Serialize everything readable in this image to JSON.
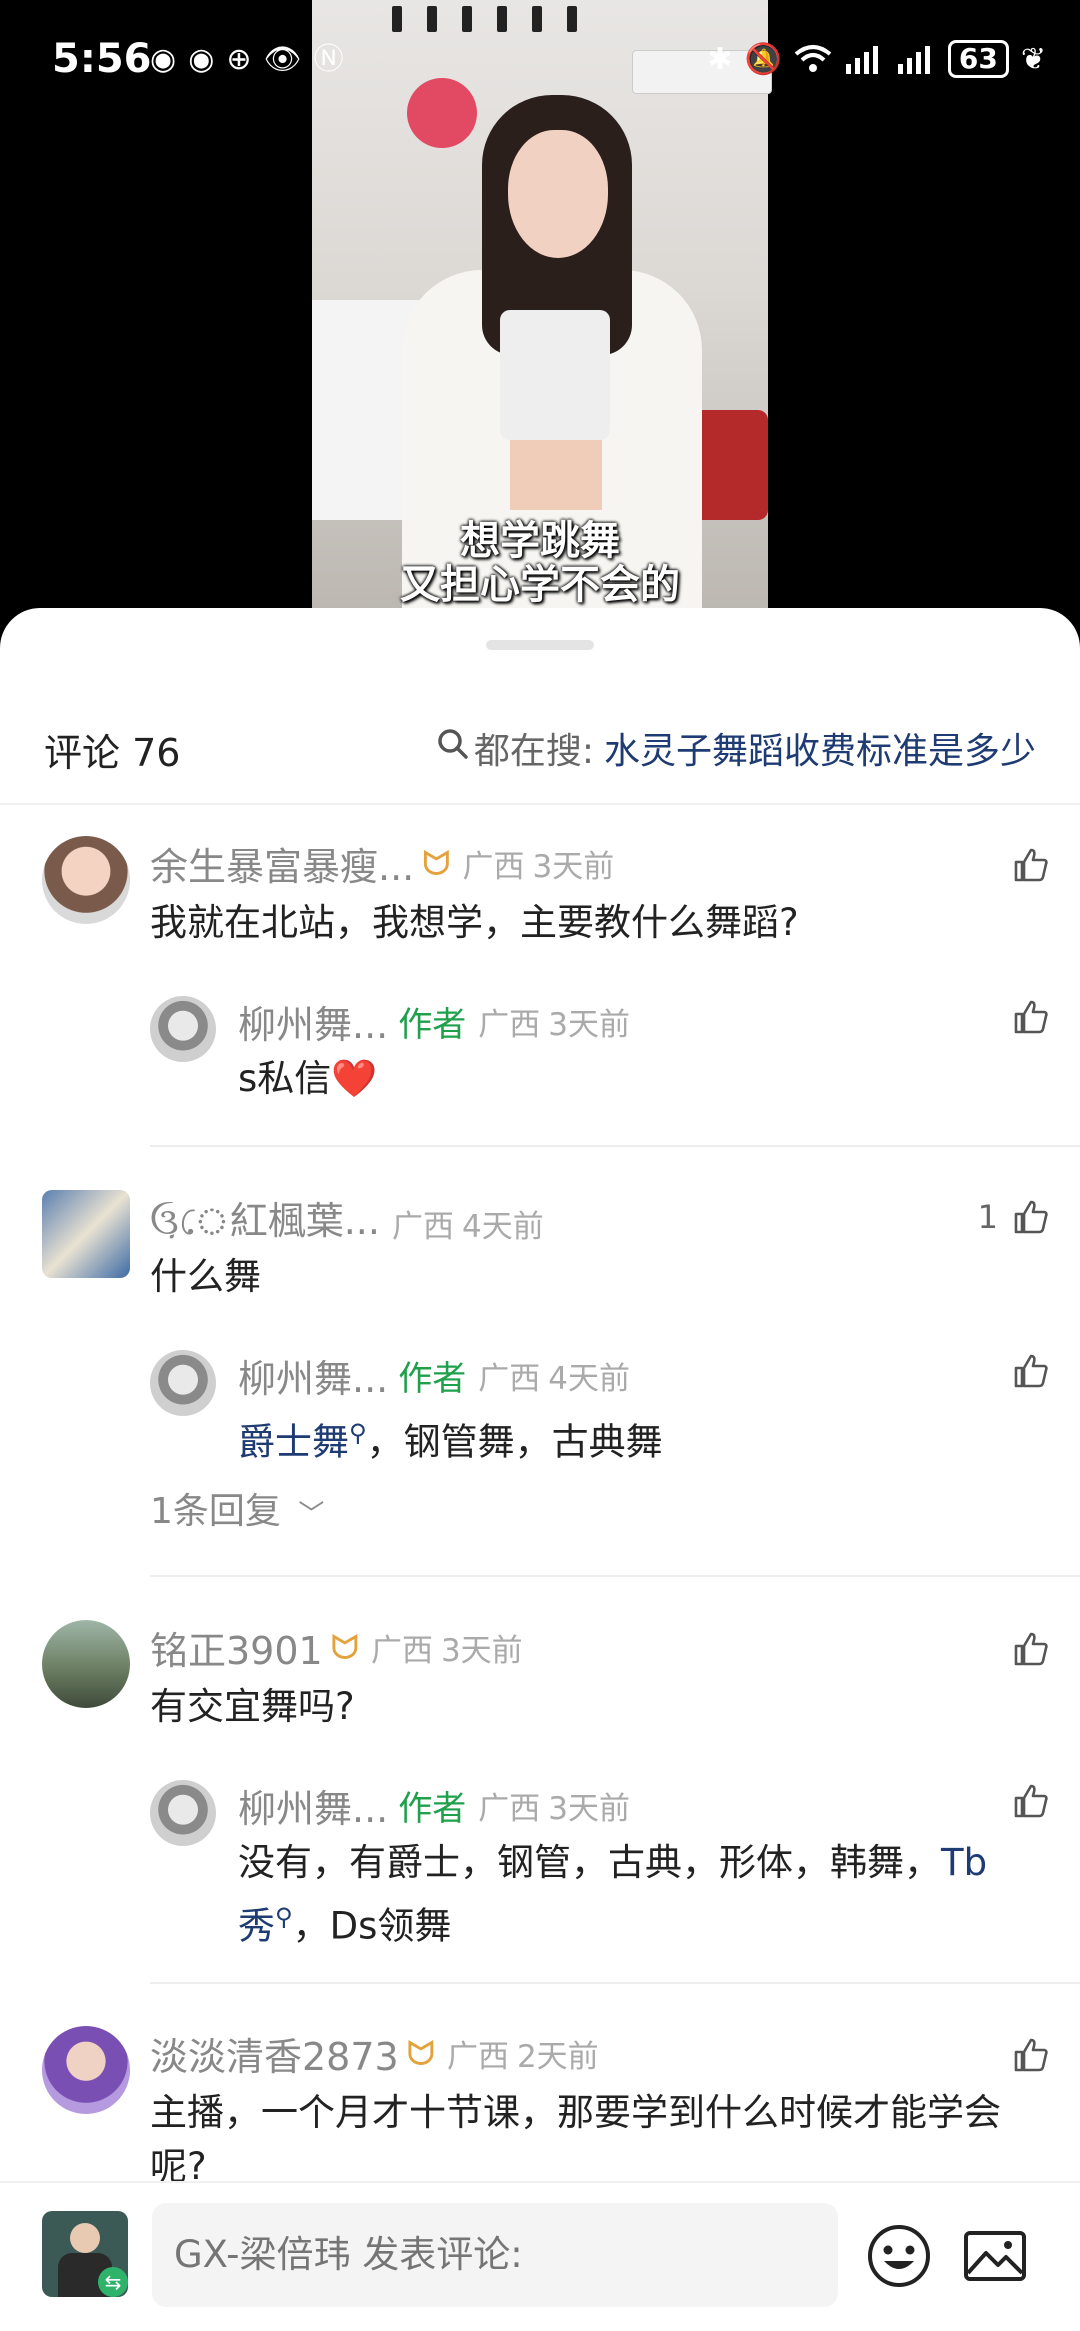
{
  "status_bar": {
    "time": "5:56",
    "battery": "63",
    "left_icons": [
      "notification-icon",
      "notification-icon",
      "data-saver-icon",
      "eye-icon",
      "nfc-icon"
    ],
    "right_icons": [
      "bluetooth-icon",
      "mute-icon",
      "wifi-icon",
      "signal-icon",
      "signal-icon",
      "battery-icon",
      "leaf-icon"
    ]
  },
  "video": {
    "subtitle_line1": "想学跳舞",
    "subtitle_line2": "又担心学不会的"
  },
  "sheet": {
    "comment_count_label": "评论 76",
    "search_prefix": "都在搜:",
    "search_term": "水灵子舞蹈收费标准是多少"
  },
  "comments": [
    {
      "name": "余生暴富暴瘦...",
      "location": "广西",
      "time": "3天前",
      "text": "我就在北站，我想学，主要教什么舞蹈?",
      "likes": "",
      "reply": {
        "name": "柳州舞...",
        "author_tag": "作者",
        "location": "广西",
        "time": "3天前",
        "text": "s私信❤️"
      }
    },
    {
      "name": "ઉ઼ে紅楓葉...",
      "location": "广西",
      "time": "4天前",
      "text": "什么舞",
      "likes": "1",
      "reply": {
        "name": "柳州舞...",
        "author_tag": "作者",
        "location": "广西",
        "time": "4天前",
        "text_link": "爵士舞",
        "text_rest": "，钢管舞，古典舞"
      },
      "more_replies": "1条回复"
    },
    {
      "name": "铭正3901",
      "location": "广西",
      "time": "3天前",
      "text": "有交宜舞吗?",
      "likes": "",
      "reply": {
        "name": "柳州舞...",
        "author_tag": "作者",
        "location": "广西",
        "time": "3天前",
        "text_a": "没有，有爵士，钢管，古典，形体，韩舞，",
        "text_link1": "Tb",
        "text_link2": "秀",
        "text_b": "，Ds领舞"
      }
    },
    {
      "name": "淡淡清香2873",
      "location": "广西",
      "time": "2天前",
      "text": "主播，一个月才十节课，那要学到什么时候才能学会呢?",
      "likes": ""
    }
  ],
  "input": {
    "placeholder": "GX-梁倍玮 发表评论:"
  }
}
